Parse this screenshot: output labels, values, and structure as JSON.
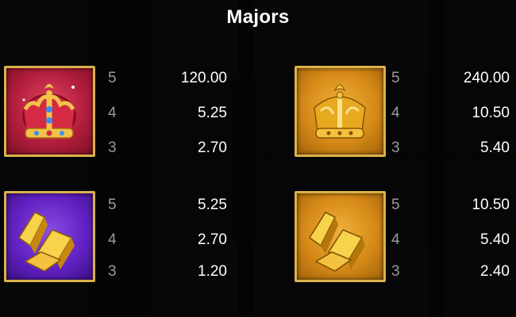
{
  "title": "Majors",
  "symbols": [
    {
      "name": "Red Crown",
      "icon": "red-crown-icon",
      "tile_color": "#b31e3c",
      "payouts": [
        {
          "count": "5",
          "value": "120.00"
        },
        {
          "count": "4",
          "value": "5.25"
        },
        {
          "count": "3",
          "value": "2.70"
        }
      ]
    },
    {
      "name": "Gold Crown",
      "icon": "gold-crown-icon",
      "tile_color": "#d68a17",
      "payouts": [
        {
          "count": "5",
          "value": "240.00"
        },
        {
          "count": "4",
          "value": "10.50"
        },
        {
          "count": "3",
          "value": "5.40"
        }
      ]
    },
    {
      "name": "Gold Bars (Purple)",
      "icon": "gold-bars-icon",
      "tile_color": "#6222c4",
      "payouts": [
        {
          "count": "5",
          "value": "5.25"
        },
        {
          "count": "4",
          "value": "2.70"
        },
        {
          "count": "3",
          "value": "1.20"
        }
      ]
    },
    {
      "name": "Gold Bars (Gold)",
      "icon": "gold-bars-icon",
      "tile_color": "#d68a17",
      "payouts": [
        {
          "count": "5",
          "value": "10.50"
        },
        {
          "count": "4",
          "value": "5.40"
        },
        {
          "count": "3",
          "value": "2.40"
        }
      ]
    }
  ]
}
